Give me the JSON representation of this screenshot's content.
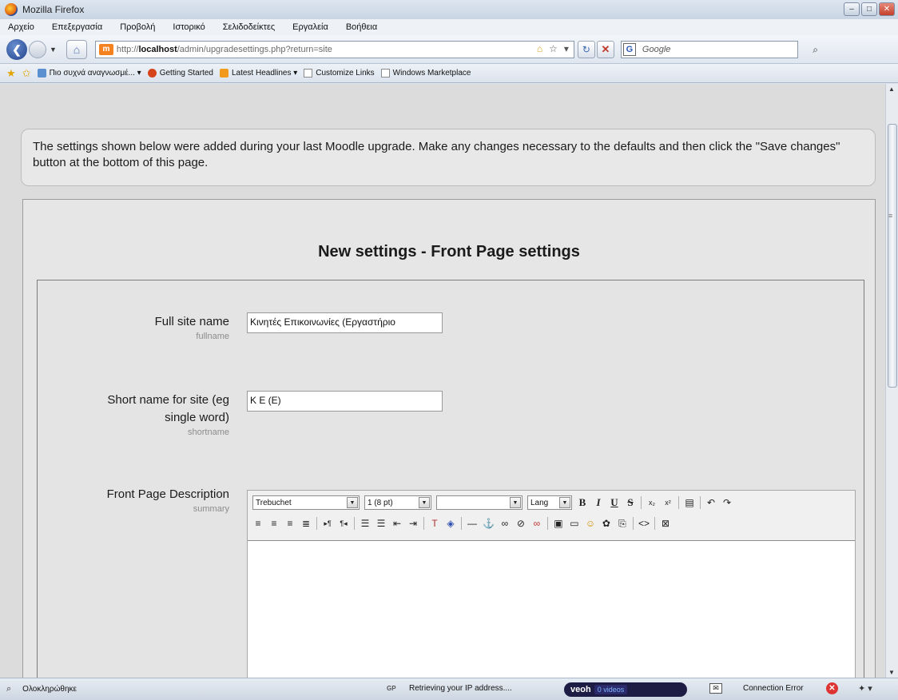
{
  "window": {
    "title": "Mozilla Firefox",
    "minimize": "–",
    "maximize": "□",
    "close": "✕"
  },
  "menu": [
    "Αρχείο",
    "Επεξεργασία",
    "Προβολή",
    "Ιστορικό",
    "Σελιδοδείκτες",
    "Εργαλεία",
    "Βοήθεια"
  ],
  "nav": {
    "back": "❮",
    "url_prefix": "http://",
    "url_host": "localhost",
    "url_path": "/admin/upgradesettings.php?return=site",
    "search_placeholder": "Google",
    "home": "⌂",
    "reload": "↻",
    "stop": "✕",
    "g_label": "G",
    "search_go": "⌕"
  },
  "bookmarks": {
    "most_visited": "Πιο συχνά αναγνωσμέ... ▾",
    "getting_started": "Getting Started",
    "latest_headlines": "Latest Headlines ▾",
    "customize_links": "Customize Links",
    "windows_marketplace": "Windows Marketplace"
  },
  "page": {
    "notice": "The settings shown below were added during your last Moodle upgrade. Make any changes necessary to the defaults and then click the \"Save changes\" button at the bottom of this page.",
    "heading": "New settings - Front Page settings",
    "fields": {
      "fullname_label": "Full site name",
      "fullname_key": "fullname",
      "fullname_value": "Κινητές Επικοινωνίες (Εργαστήριο",
      "shortname_label_1": "Short name for site (eg",
      "shortname_label_2": "single word)",
      "shortname_key": "shortname",
      "shortname_value": "K E (E)",
      "summary_label": "Front Page Description",
      "summary_key": "summary"
    },
    "editor": {
      "font": "Trebuchet",
      "size": "1 (8 pt)",
      "format": "",
      "lang": "Lang",
      "bold": "B",
      "italic": "I",
      "underline": "U",
      "strike": "S"
    }
  },
  "status": {
    "done": "Ολοκληρώθηκε",
    "gp": "GP",
    "ip": "Retrieving your IP address....",
    "veoh": "veoh",
    "veoh_videos": "0 videos",
    "connection": "Connection Error"
  }
}
